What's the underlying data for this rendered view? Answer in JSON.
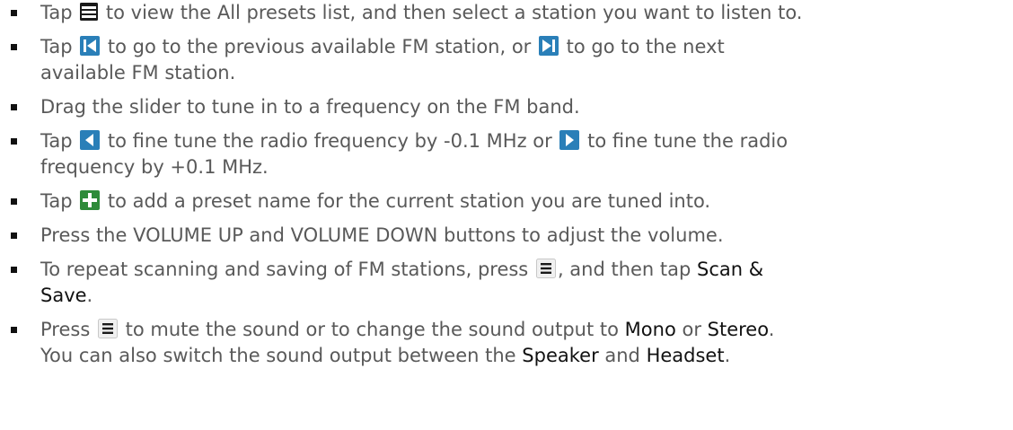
{
  "items": [
    {
      "parts": [
        {
          "t": "text",
          "v": "Tap "
        },
        {
          "t": "icon",
          "icon": "list-icon"
        },
        {
          "t": "text",
          "v": " to view the All presets list, and then select a station you want to listen to."
        }
      ]
    },
    {
      "parts": [
        {
          "t": "text",
          "v": "Tap "
        },
        {
          "t": "icon",
          "icon": "previous-station-icon"
        },
        {
          "t": "text",
          "v": " to go to the previous available FM station, or "
        },
        {
          "t": "icon",
          "icon": "next-station-icon"
        },
        {
          "t": "text",
          "v": " to go to the next"
        },
        {
          "t": "br"
        },
        {
          "t": "text",
          "v": "available FM station."
        }
      ]
    },
    {
      "parts": [
        {
          "t": "text",
          "v": "Drag the slider to tune in to a frequency on the FM band."
        }
      ]
    },
    {
      "parts": [
        {
          "t": "text",
          "v": "Tap "
        },
        {
          "t": "icon",
          "icon": "fine-tune-down-icon"
        },
        {
          "t": "text",
          "v": " to fine tune the radio frequency by -0.1 MHz or "
        },
        {
          "t": "icon",
          "icon": "fine-tune-up-icon"
        },
        {
          "t": "text",
          "v": " to fine tune the radio"
        },
        {
          "t": "br"
        },
        {
          "t": "text",
          "v": "frequency by +0.1 MHz."
        }
      ]
    },
    {
      "parts": [
        {
          "t": "text",
          "v": "Tap "
        },
        {
          "t": "icon",
          "icon": "add-preset-icon"
        },
        {
          "t": "text",
          "v": " to add a preset name for the current station you are tuned into."
        }
      ]
    },
    {
      "parts": [
        {
          "t": "text",
          "v": "Press the VOLUME UP and VOLUME DOWN buttons to adjust the volume."
        }
      ]
    },
    {
      "parts": [
        {
          "t": "text",
          "v": "To repeat scanning and saving of FM stations, press "
        },
        {
          "t": "icon",
          "icon": "menu-key-icon"
        },
        {
          "t": "text",
          "v": ", and then tap "
        },
        {
          "t": "kw",
          "v": "Scan &"
        },
        {
          "t": "br"
        },
        {
          "t": "kw",
          "v": "Save"
        },
        {
          "t": "text",
          "v": "."
        }
      ]
    },
    {
      "parts": [
        {
          "t": "text",
          "v": "Press "
        },
        {
          "t": "icon",
          "icon": "menu-key-icon"
        },
        {
          "t": "text",
          "v": " to mute the sound or to change the sound output to "
        },
        {
          "t": "kw",
          "v": "Mono"
        },
        {
          "t": "text",
          "v": " or "
        },
        {
          "t": "kw",
          "v": "Stereo"
        },
        {
          "t": "text",
          "v": "."
        },
        {
          "t": "br"
        },
        {
          "t": "text",
          "v": "You can also switch the sound output between the "
        },
        {
          "t": "kw",
          "v": "Speaker"
        },
        {
          "t": "text",
          "v": " and "
        },
        {
          "t": "kw",
          "v": "Headset"
        },
        {
          "t": "text",
          "v": "."
        }
      ]
    }
  ],
  "colors": {
    "text": "#595959",
    "keyword": "#111111",
    "bullet": "#111111",
    "icon_dark": "#1a1a1a",
    "icon_blue": "#2a7fb8",
    "icon_green": "#2e8b3a"
  }
}
